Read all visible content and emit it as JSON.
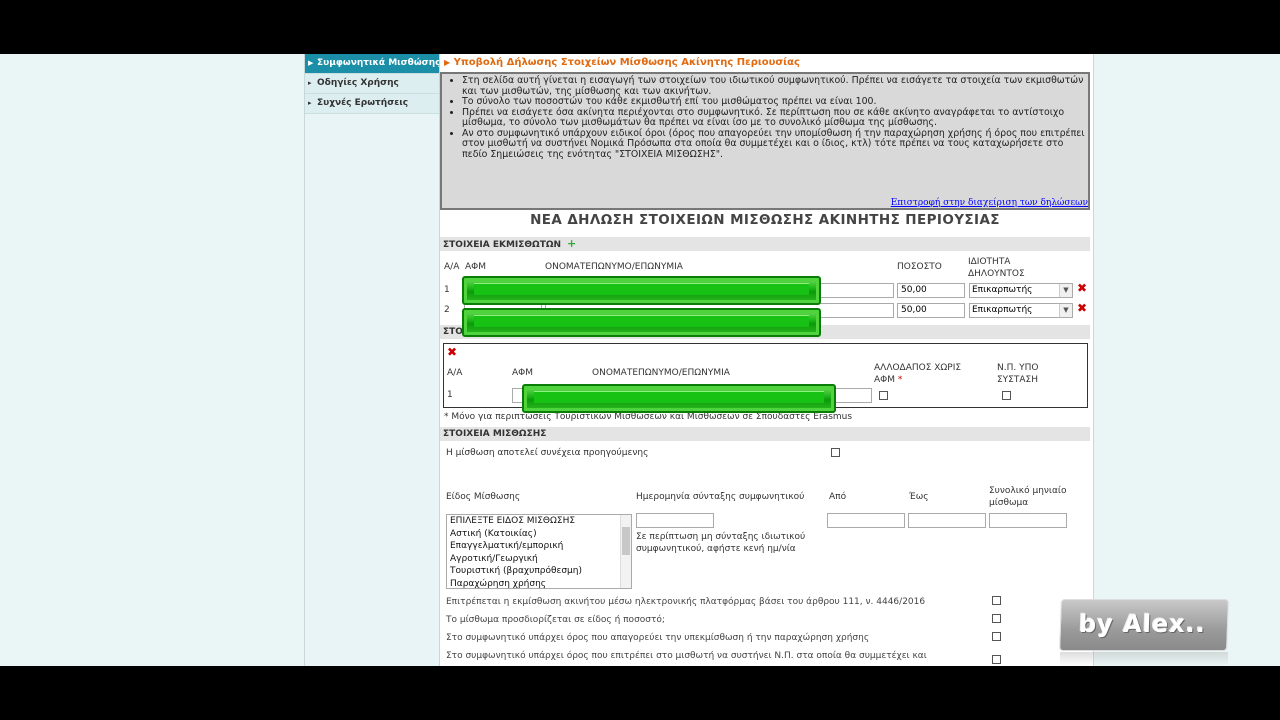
{
  "sidebar": {
    "items": [
      {
        "label": "Συμφωνητικά Μισθώσης",
        "active": true
      },
      {
        "label": "Οδηγίες Χρήσης",
        "active": false
      },
      {
        "label": "Συχνές Ερωτήσεις",
        "active": false
      }
    ]
  },
  "breadcrumb": "Υποβολή Δήλωσης Στοιχείων Μίσθωσης Ακίνητης Περιουσίας",
  "info": {
    "bullets": [
      "Στη σελίδα αυτή γίνεται η εισαγωγή των στοιχείων του ιδιωτικού συμφωνητικού. Πρέπει να εισάγετε τα στοιχεία των εκμισθωτών και των μισθωτών, της μίσθωσης και των ακινήτων.",
      "Το σύνολο των ποσοστών του κάθε εκμισθωτή επί του μισθώματος πρέπει να είναι 100.",
      "Πρέπει να εισάγετε όσα ακίνητα περιέχονται στο συμφωνητικό. Σε περίπτωση που σε κάθε ακίνητο αναγράφεται το αντίστοιχο μίσθωμα, το σύνολο των μισθωμάτων θα πρέπει να είναι ίσο με το συνολικό μίσθωμα της μίσθωσης.",
      "Αν στο συμφωνητικό υπάρχουν ειδικοί όροι (όρος που απαγορεύει την υπομίσθωση ή την παραχώρηση χρήσης ή όρος που επιτρέπει στον μισθωτή να συστήνει Νομικά Πρόσωπα στα οποία θα συμμετέχει και ο ίδιος, κτλ) τότε πρέπει να τους καταχωρήσετε στο πεδίο Σημειώσεις της ενότητας \"ΣΤΟΙΧΕΙΑ ΜΙΣΘΩΣΗΣ\"."
    ],
    "back_link": "Επιστροφή στην διαχείριση των δηλώσεων"
  },
  "form_title": "ΝΕΑ ΔΗΛΩΣΗ ΣΤΟΙΧΕΙΩΝ ΜΙΣΘΩΣΗΣ ΑΚΙΝΗΤΗΣ ΠΕΡΙΟΥΣΙΑΣ",
  "lessors": {
    "section_title": "ΣΤΟΙΧΕΙΑ ΕΚΜΙΣΘΩΤΩΝ",
    "add_symbol": "+",
    "columns": {
      "aa": "Α/Α",
      "afm": "ΑΦΜ",
      "name": "ΟΝΟΜΑΤΕΠΩΝΥΜΟ/ΕΠΩΝΥΜΙΑ",
      "percent": "ΠΟΣΟΣΤΟ",
      "capacity": "ΙΔΙΟΤΗΤΑ ΔΗΛΟΥΝΤΟΣ"
    },
    "rows": [
      {
        "aa": "1",
        "percent": "50,00",
        "capacity": "Επικαρπωτής"
      },
      {
        "aa": "2",
        "percent": "50,00",
        "capacity": "Επικαρπωτής"
      }
    ]
  },
  "lessees": {
    "section_title_partial": "ΣΤΟ",
    "columns": {
      "aa": "Α/Α",
      "afm": "ΑΦΜ",
      "name": "ΟΝΟΜΑΤΕΠΩΝΥΜΟ/ΕΠΩΝΥΜΙΑ",
      "foreign": "ΑΛΛΟΔΑΠΟΣ ΧΩΡΙΣ ΑΦΜ",
      "foreign_star": "*",
      "np": "Ν.Π. ΥΠΟ ΣΥΣΤΑΣΗ"
    },
    "rows": [
      {
        "aa": "1"
      }
    ],
    "footnote": "* Μόνο για περιπτώσεις Τουριστικών Μισθώσεων και Μισθώσεων σε Σπουδαστές Erasmus"
  },
  "lease": {
    "section_title": "ΣΤΟΙΧΕΙΑ ΜΙΣΘΩΣΗΣ",
    "continuation_label": "Η μίσθωση αποτελεί συνέχεια προηγούμενης",
    "type_label": "Είδος Μίσθωσης",
    "date_label": "Ημερομηνία σύνταξης συμφωνητικού",
    "date_hint": "Σε περίπτωση μη σύνταξης ιδιωτικού συμφωνητικού, αφήστε κενή ημ/νία",
    "from_label": "Από",
    "to_label": "Έως",
    "total_label": "Συνολικό μηνιαίο μίσθωμα",
    "type_options": [
      "ΕΠΙΛΕΞΤΕ ΕΙΔΟΣ ΜΙΣΘΩΣΗΣ",
      "Αστική (Κατοικίας)",
      "Επαγγελματική/εμπορική",
      "Αγροτική/Γεωργική",
      "Τουριστική (βραχυπρόθεσμη)",
      "Παραχώρηση χρήσης"
    ],
    "questions": [
      "Επιτρέπεται η εκμίσθωση ακινήτου μέσω ηλεκτρονικής πλατφόρμας βάσει του άρθρου 111, ν. 4446/2016",
      "Το μίσθωμα προσδιορίζεται σε είδος ή ποσοστό;",
      "Στο συμφωνητικό υπάρχει όρος που απαγορεύει την υπεκμίσθωση ή την παραχώρηση χρήσης",
      "Στο συμφωνητικό υπάρχει όρος που επιτρέπει στο μισθωτή να συστήνει Ν.Π. στα οποία θα συμμετέχει και"
    ]
  },
  "watermark": "by Alex..",
  "colors": {
    "accent": "#1c8fa8",
    "breadcrumb": "#e06a10",
    "delete": "#cc0000",
    "redaction": "#18b015"
  }
}
